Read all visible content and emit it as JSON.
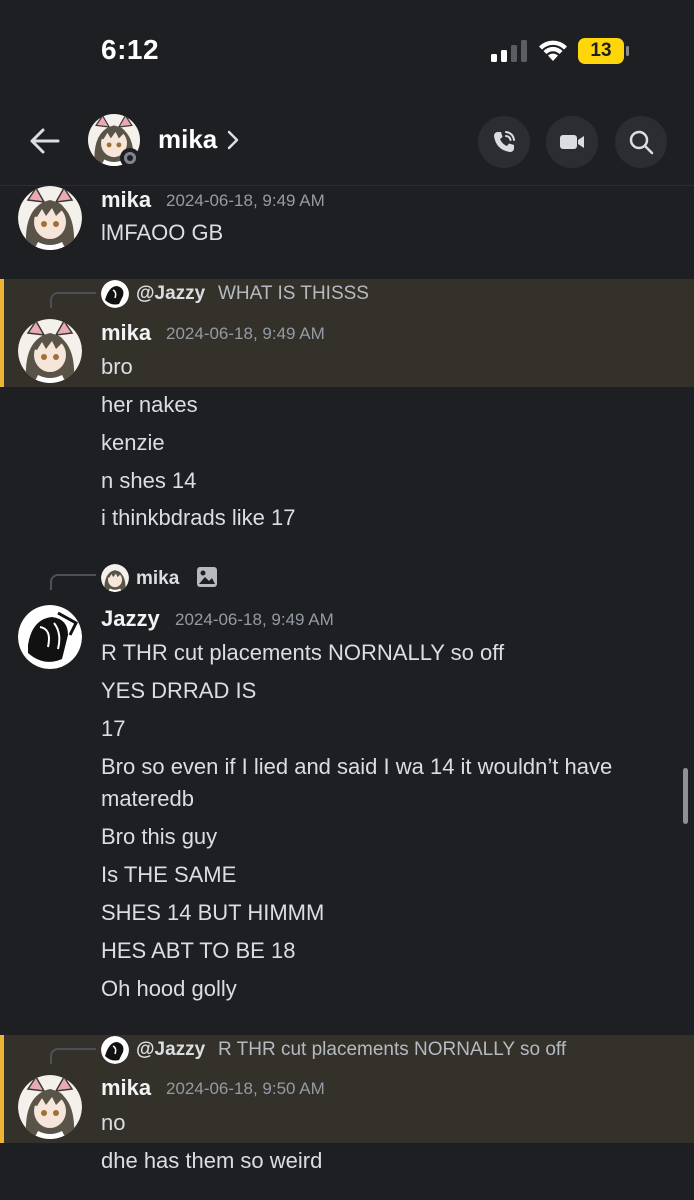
{
  "status_bar": {
    "time": "6:12",
    "battery": "13",
    "battery_color": "#ffd60a"
  },
  "header": {
    "name": "mika",
    "icons": [
      "back-arrow-icon",
      "chevron-right-icon",
      "phone-call-icon",
      "video-camera-icon",
      "search-icon"
    ]
  },
  "messages": [
    {
      "author": "mika",
      "timestamp": "2024-06-18, 9:49 AM",
      "lines": [
        "lMFAOO GB"
      ]
    },
    {
      "highlighted": true,
      "reply_to": {
        "name": "@Jazzy",
        "text": "WHAT IS THISSS"
      },
      "author": "mika",
      "timestamp": "2024-06-18, 9:49 AM",
      "lines": [
        "bro",
        "her nakes",
        "kenzie",
        "n shes 14",
        "i thinkbdrads like 17"
      ]
    },
    {
      "reply_to": {
        "name": "mika",
        "text": "",
        "attachment_icon": "image-icon"
      },
      "author": "Jazzy",
      "timestamp": "2024-06-18, 9:49 AM",
      "lines": [
        "R THR cut placements NORNALLY so off",
        "YES DRRAD IS",
        "17",
        "Bro so even if I lied and said I wa 14 it wouldn’t have",
        "materedb",
        "Bro this guy",
        "Is THE SAME",
        "SHES 14 BUT HIMMM",
        "HES ABT TO BE 18",
        "Oh hood golly"
      ]
    },
    {
      "highlighted": true,
      "reply_to": {
        "name": "@Jazzy",
        "text": "R THR cut placements NORNALLY so off"
      },
      "author": "mika",
      "timestamp": "2024-06-18, 9:50 AM",
      "lines": [
        "no",
        "dhe has them so weird"
      ]
    }
  ],
  "colors": {
    "background": "#1e1f22",
    "highlight_bg": "#34302a",
    "highlight_bar": "#f0b232",
    "timestamp": "#949ba4"
  }
}
